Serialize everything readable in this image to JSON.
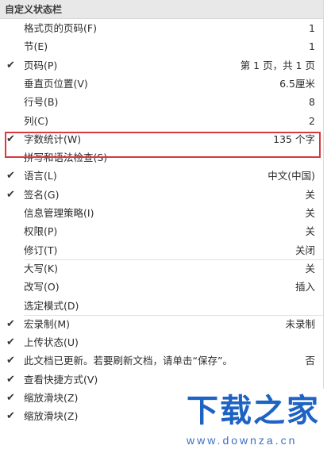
{
  "menu": {
    "header": "自定义状态栏",
    "items": [
      {
        "label": "格式页的页码(F)",
        "value": "1",
        "checked": false
      },
      {
        "label": "节(E)",
        "value": "1",
        "checked": false
      },
      {
        "label": "页码(P)",
        "value": "第 1 页，共 1 页",
        "checked": true
      },
      {
        "label": "垂直页位置(V)",
        "value": "6.5厘米",
        "checked": false
      },
      {
        "label": "行号(B)",
        "value": "8",
        "checked": false
      },
      {
        "label": "列(C)",
        "value": "2",
        "checked": false
      },
      {
        "label": "字数统计(W)",
        "value": "135 个字",
        "checked": true
      },
      {
        "label": "拼写和语法检查(S)",
        "value": "",
        "checked": false
      },
      {
        "label": "语言(L)",
        "value": "中文(中国)",
        "checked": true
      },
      {
        "label": "签名(G)",
        "value": "关",
        "checked": true
      },
      {
        "label": "信息管理策略(I)",
        "value": "关",
        "checked": false
      },
      {
        "label": "权限(P)",
        "value": "关",
        "checked": false
      },
      {
        "label": "修订(T)",
        "value": "关闭",
        "checked": false
      },
      {
        "label": "大写(K)",
        "value": "关",
        "checked": false
      },
      {
        "label": "改写(O)",
        "value": "插入",
        "checked": false
      },
      {
        "label": "选定模式(D)",
        "value": "",
        "checked": false
      },
      {
        "label": "宏录制(M)",
        "value": "未录制",
        "checked": true
      },
      {
        "label": "上传状态(U)",
        "value": "",
        "checked": true
      },
      {
        "label": "此文档已更新。若要刷新文档，请单击“保存”。",
        "value": "否",
        "checked": true
      },
      {
        "label": "查看快捷方式(V)",
        "value": "",
        "checked": true
      },
      {
        "label": "缩放滑块(Z)",
        "value": "",
        "checked": true
      },
      {
        "label": "缩放滑块(Z)",
        "value": "",
        "checked": true
      }
    ]
  },
  "check_glyph": "✔",
  "watermark": {
    "title": "下载之家",
    "url": "www.downza.cn"
  },
  "colors": {
    "highlight": "#d9393e",
    "watermark": "#1d63c4"
  }
}
